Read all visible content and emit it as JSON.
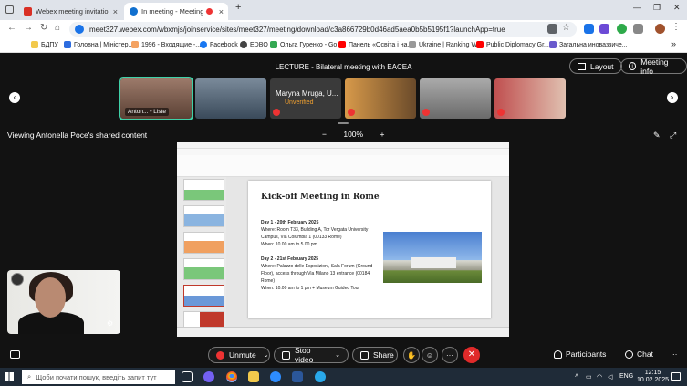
{
  "browser": {
    "tabs": [
      {
        "title": "Webex meeting invitation: LEC",
        "icon_color": "#d93025"
      },
      {
        "title": "In meeting - Meeting - Webex",
        "icon_color": "#1170cf"
      }
    ],
    "new_tab": "+",
    "url": "meet327.webex.com/wbxmjs/joinservice/sites/meet327/meeting/download/c3a866729b0d46ad5aea0b5b5195f1?launchApp=true",
    "bookmarks": [
      {
        "label": "БДПУ",
        "icon": "folder-icon",
        "color": "#f2c94c"
      },
      {
        "label": "Головна | Міністер...",
        "icon": "ministry-icon",
        "color": "#2d6cdf"
      },
      {
        "label": "1996 - Входящие -...",
        "icon": "mail-icon",
        "color": "#f4a261"
      },
      {
        "label": "Facebook",
        "icon": "facebook-icon",
        "color": "#1877f2"
      },
      {
        "label": "EDBO",
        "icon": "globe-icon",
        "color": "#444444"
      },
      {
        "label": "Ольга Гуренко - Go...",
        "icon": "google-icon",
        "color": "#34a853"
      },
      {
        "label": "Панель «Освіта і на...",
        "icon": "youtube-icon",
        "color": "#ff0000"
      },
      {
        "label": "Ukraine | Ranking W...",
        "icon": "ranking-icon",
        "color": "#999999"
      },
      {
        "label": "Public Diplomacy Gr...",
        "icon": "youtube-icon",
        "color": "#ff0000"
      },
      {
        "label": "Загальна иноваззиче...",
        "icon": "doc-icon",
        "color": "#6a5acd"
      }
    ],
    "more_bookmarks": "»"
  },
  "meeting": {
    "title": "LECTURE - Bilateral meeting with EACEA",
    "layout_label": "Layout",
    "info_label": "Meeting info",
    "participants": [
      {
        "label": "Anton... • Liste",
        "tone": "#7a5a4a"
      },
      {
        "label": "",
        "tone": "#5a6a7a"
      },
      {
        "label": "Maryna Mruga, U...",
        "sub": "Unverified",
        "tone": "#3a3a3a"
      },
      {
        "label": "",
        "tone": "#c08a4a"
      },
      {
        "label": "",
        "tone": "#8a8a8a"
      },
      {
        "label": "",
        "tone": "#b04a4a"
      }
    ],
    "viewing_text": "Viewing Antonella Poce's shared content",
    "zoom_minus": "−",
    "zoom_value": "100%",
    "zoom_plus": "+",
    "slide": {
      "title": "Kick-off Meeting in Rome",
      "day1": "Day 1 - 20th February 2025",
      "day1_where": "Where: Room T33, Building A, Tor Vergata University Campus, Via Columbia 1 (00133 Rome)",
      "day1_when": "When: 10.00 am to 5.00 pm",
      "day2": "Day 2 - 21st February 2025",
      "day2_where": "Where: Palazzo delle Esposizioni, Sala Forum (Ground Floor), access through Via Milano 13 entrance (00184 Rome)",
      "day2_when": "When: 10.00 am to 1 pm + Museum Guided Tour"
    },
    "controls": {
      "unmute": "Unmute",
      "stop_video": "Stop video",
      "share": "Share",
      "participants": "Participants",
      "chat": "Chat"
    }
  },
  "taskbar": {
    "search_placeholder": "Щоби почати пошук, введіть запит тут",
    "lang": "ENG",
    "time": "12:15",
    "date": "10.02.2025"
  }
}
